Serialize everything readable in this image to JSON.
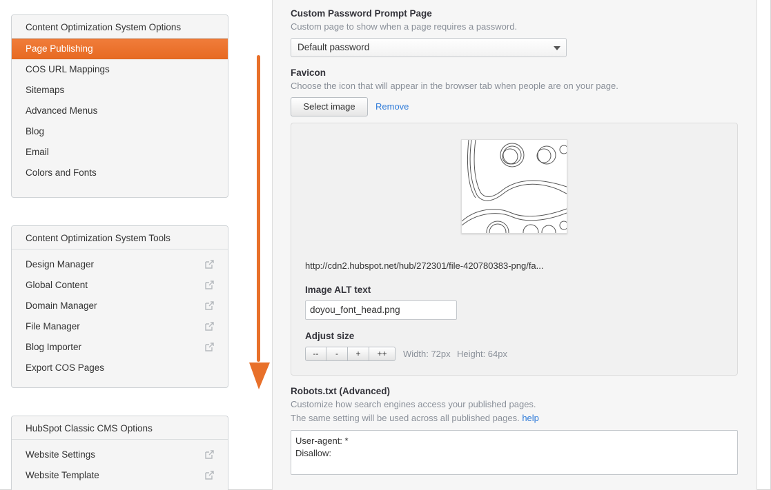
{
  "sidebar": {
    "cos_options": {
      "title": "Content Optimization System Options",
      "items": [
        {
          "label": "Page Publishing"
        },
        {
          "label": "COS URL Mappings"
        },
        {
          "label": "Sitemaps"
        },
        {
          "label": "Advanced Menus"
        },
        {
          "label": "Blog"
        },
        {
          "label": "Email"
        },
        {
          "label": "Colors and Fonts"
        }
      ]
    },
    "cos_tools": {
      "title": "Content Optimization System Tools",
      "items": [
        {
          "label": "Design Manager"
        },
        {
          "label": "Global Content"
        },
        {
          "label": "Domain Manager"
        },
        {
          "label": "File Manager"
        },
        {
          "label": "Blog Importer"
        },
        {
          "label": "Export COS Pages"
        }
      ]
    },
    "classic": {
      "title": "HubSpot Classic CMS Options",
      "items": [
        {
          "label": "Website Settings"
        },
        {
          "label": "Website Template"
        }
      ]
    }
  },
  "password": {
    "label": "Custom Password Prompt Page",
    "help": "Custom page to show when a page requires a password.",
    "selected": "Default password"
  },
  "favicon": {
    "label": "Favicon",
    "help": "Choose the icon that will appear in the browser tab when people are on your page.",
    "select_button": "Select image",
    "remove_link": "Remove",
    "url": "http://cdn2.hubspot.net/hub/272301/file-420780383-png/fa...",
    "alt_label": "Image ALT text",
    "alt_value": "doyou_font_head.png",
    "size_label": "Adjust size",
    "size_buttons": [
      "--",
      "-",
      "+",
      "++"
    ],
    "width_text": "Width: 72px",
    "height_text": "Height: 64px"
  },
  "robots": {
    "label": "Robots.txt (Advanced)",
    "help1": "Customize how search engines access your published pages.",
    "help2": "The same setting will be used across all published pages.",
    "help_link": "help",
    "content": "User-agent: *\nDisallow:"
  },
  "colors": {
    "accent": "#e8702a",
    "link": "#2f7bd9"
  }
}
